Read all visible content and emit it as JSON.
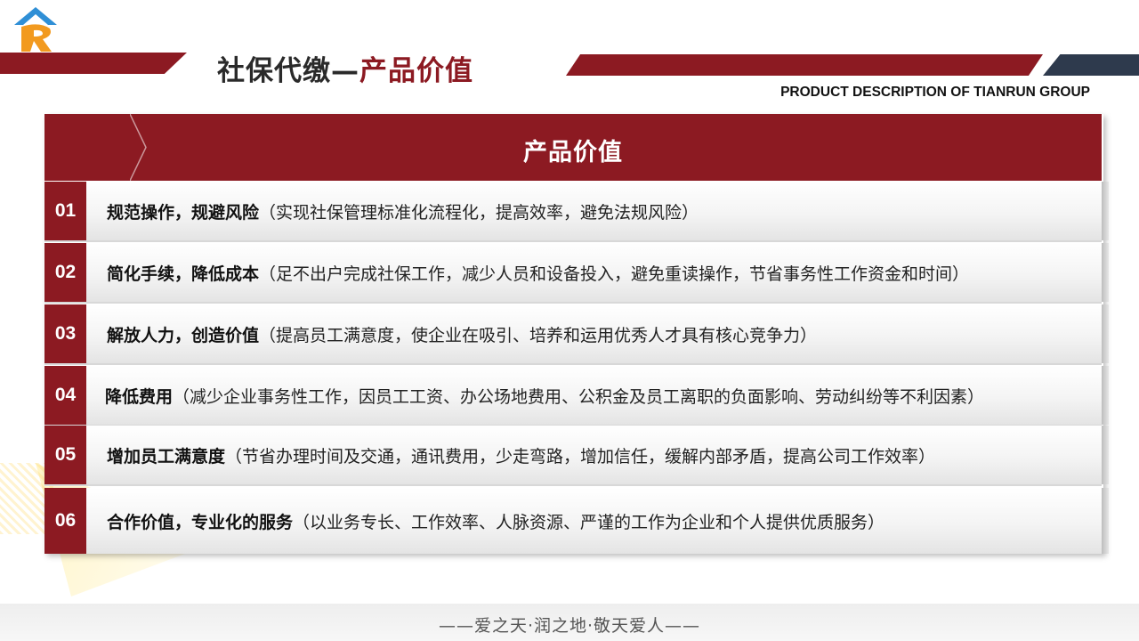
{
  "header": {
    "title_prefix": "社保代缴—",
    "title_accent": "产品价值",
    "subtitle": "PRODUCT DESCRIPTION OF TIANRUN GROUP"
  },
  "panel": {
    "header_label": "产品价值",
    "rows": [
      {
        "num": "01",
        "head": "规范操作，规避风险",
        "desc": "（实现社保管理标准化流程化，提高效率，避免法规风险）"
      },
      {
        "num": "02",
        "head": "简化手续，降低成本",
        "desc": "（足不出户完成社保工作，减少人员和设备投入，避免重读操作，节省事务性工作资金和时间）"
      },
      {
        "num": "03",
        "head": "解放人力，创造价值",
        "desc": "（提高员工满意度，使企业在吸引、培养和运用优秀人才具有核心竞争力）"
      },
      {
        "num": "04",
        "head": "降低费用",
        "desc": "（减少企业事务性工作，因员工工资、办公场地费用、公积金及员工离职的负面影响、劳动纠纷等不利因素）"
      },
      {
        "num": "05",
        "head": "增加员工满意度",
        "desc": "（节省办理时间及交通，通讯费用，少走弯路，增加信任，缓解内部矛盾，提高公司工作效率）"
      },
      {
        "num": "06",
        "head": "合作价值，专业化的服务",
        "desc": " （以业务专长、工作效率、人脉资源、严谨的工作为企业和个人提供优质服务）"
      }
    ]
  },
  "footer": {
    "motto": "——爱之天·润之地·敬天爱人——"
  },
  "colors": {
    "brand_red": "#8c1a22",
    "navy": "#2e3a4d"
  }
}
